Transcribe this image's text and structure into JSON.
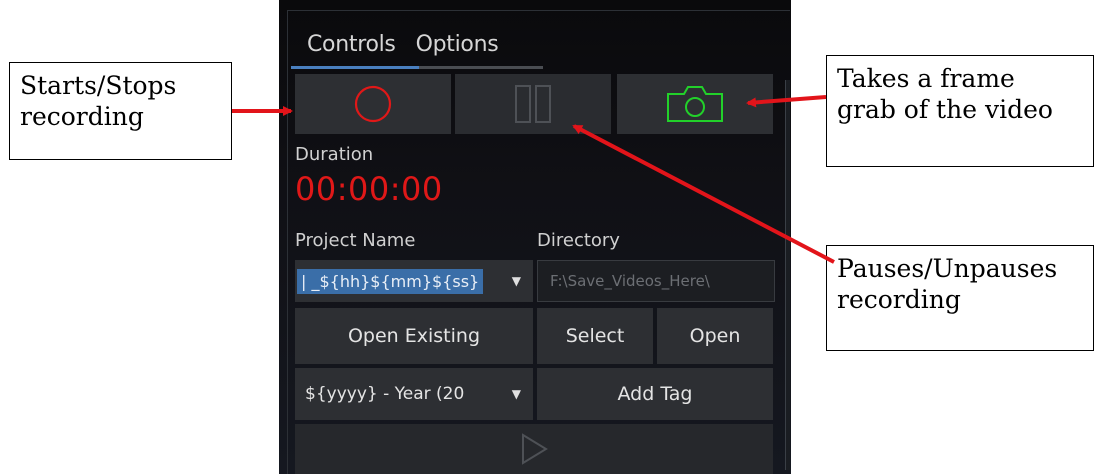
{
  "tabs": [
    "Controls",
    "Options"
  ],
  "duration": {
    "label": "Duration",
    "value": "00:00:00"
  },
  "project_name": {
    "label": "Project Name",
    "value": "| _${hh}${mm}${ss}"
  },
  "directory": {
    "label": "Directory",
    "placeholder": "F:\\Save_Videos_Here\\"
  },
  "buttons": {
    "open_existing": "Open Existing",
    "select": "Select",
    "open": "Open",
    "add_tag": "Add Tag"
  },
  "tag_dropdown": {
    "value": "${yyyy} - Year (20"
  },
  "annotations": {
    "record": [
      "Starts/Stops",
      "recording"
    ],
    "snapshot": [
      "Takes a frame",
      "grab of the video"
    ],
    "pause": [
      "Pauses/Unpauses",
      "recording"
    ]
  },
  "colors": {
    "record": "#e01818",
    "snapshot": "#22d12a",
    "arrow": "#e2141a",
    "tab_accent": "#4a80c0",
    "selection": "#3a6ea8"
  },
  "icons": {
    "record": "record-circle-icon",
    "pause": "pause-bars-icon",
    "snapshot": "camera-icon",
    "play": "play-triangle-icon",
    "dropdown": "chevron-down-icon"
  }
}
